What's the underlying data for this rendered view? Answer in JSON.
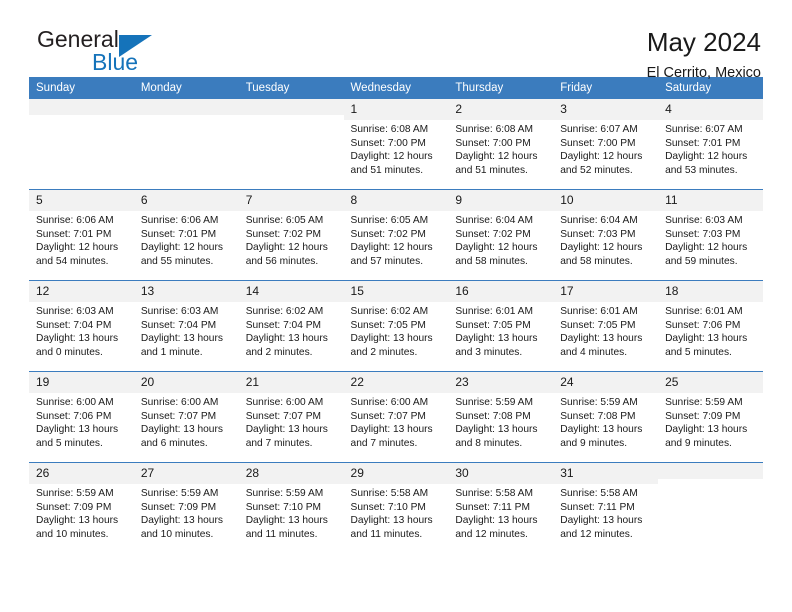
{
  "brand": {
    "name_top": "General",
    "name_bottom": "Blue",
    "triangle_color": "#1573ba",
    "text_color": "#231f20"
  },
  "header": {
    "title": "May 2024",
    "subtitle": "El Cerrito, Mexico",
    "header_bg": "#3b7cbe",
    "header_text": "#ffffff"
  },
  "weekday_headers": [
    "Sunday",
    "Monday",
    "Tuesday",
    "Wednesday",
    "Thursday",
    "Friday",
    "Saturday"
  ],
  "labels": {
    "sunrise": "Sunrise:",
    "sunset": "Sunset:",
    "daylight": "Daylight:"
  },
  "weeks": [
    [
      {
        "day": "",
        "empty": true
      },
      {
        "day": "",
        "empty": true
      },
      {
        "day": "",
        "empty": true
      },
      {
        "day": "1",
        "sunrise": "Sunrise: 6:08 AM",
        "sunset": "Sunset: 7:00 PM",
        "daylight_1": "Daylight: 12 hours",
        "daylight_2": "and 51 minutes."
      },
      {
        "day": "2",
        "sunrise": "Sunrise: 6:08 AM",
        "sunset": "Sunset: 7:00 PM",
        "daylight_1": "Daylight: 12 hours",
        "daylight_2": "and 51 minutes."
      },
      {
        "day": "3",
        "sunrise": "Sunrise: 6:07 AM",
        "sunset": "Sunset: 7:00 PM",
        "daylight_1": "Daylight: 12 hours",
        "daylight_2": "and 52 minutes."
      },
      {
        "day": "4",
        "sunrise": "Sunrise: 6:07 AM",
        "sunset": "Sunset: 7:01 PM",
        "daylight_1": "Daylight: 12 hours",
        "daylight_2": "and 53 minutes."
      }
    ],
    [
      {
        "day": "5",
        "sunrise": "Sunrise: 6:06 AM",
        "sunset": "Sunset: 7:01 PM",
        "daylight_1": "Daylight: 12 hours",
        "daylight_2": "and 54 minutes."
      },
      {
        "day": "6",
        "sunrise": "Sunrise: 6:06 AM",
        "sunset": "Sunset: 7:01 PM",
        "daylight_1": "Daylight: 12 hours",
        "daylight_2": "and 55 minutes."
      },
      {
        "day": "7",
        "sunrise": "Sunrise: 6:05 AM",
        "sunset": "Sunset: 7:02 PM",
        "daylight_1": "Daylight: 12 hours",
        "daylight_2": "and 56 minutes."
      },
      {
        "day": "8",
        "sunrise": "Sunrise: 6:05 AM",
        "sunset": "Sunset: 7:02 PM",
        "daylight_1": "Daylight: 12 hours",
        "daylight_2": "and 57 minutes."
      },
      {
        "day": "9",
        "sunrise": "Sunrise: 6:04 AM",
        "sunset": "Sunset: 7:02 PM",
        "daylight_1": "Daylight: 12 hours",
        "daylight_2": "and 58 minutes."
      },
      {
        "day": "10",
        "sunrise": "Sunrise: 6:04 AM",
        "sunset": "Sunset: 7:03 PM",
        "daylight_1": "Daylight: 12 hours",
        "daylight_2": "and 58 minutes."
      },
      {
        "day": "11",
        "sunrise": "Sunrise: 6:03 AM",
        "sunset": "Sunset: 7:03 PM",
        "daylight_1": "Daylight: 12 hours",
        "daylight_2": "and 59 minutes."
      }
    ],
    [
      {
        "day": "12",
        "sunrise": "Sunrise: 6:03 AM",
        "sunset": "Sunset: 7:04 PM",
        "daylight_1": "Daylight: 13 hours",
        "daylight_2": "and 0 minutes."
      },
      {
        "day": "13",
        "sunrise": "Sunrise: 6:03 AM",
        "sunset": "Sunset: 7:04 PM",
        "daylight_1": "Daylight: 13 hours",
        "daylight_2": "and 1 minute."
      },
      {
        "day": "14",
        "sunrise": "Sunrise: 6:02 AM",
        "sunset": "Sunset: 7:04 PM",
        "daylight_1": "Daylight: 13 hours",
        "daylight_2": "and 2 minutes."
      },
      {
        "day": "15",
        "sunrise": "Sunrise: 6:02 AM",
        "sunset": "Sunset: 7:05 PM",
        "daylight_1": "Daylight: 13 hours",
        "daylight_2": "and 2 minutes."
      },
      {
        "day": "16",
        "sunrise": "Sunrise: 6:01 AM",
        "sunset": "Sunset: 7:05 PM",
        "daylight_1": "Daylight: 13 hours",
        "daylight_2": "and 3 minutes."
      },
      {
        "day": "17",
        "sunrise": "Sunrise: 6:01 AM",
        "sunset": "Sunset: 7:05 PM",
        "daylight_1": "Daylight: 13 hours",
        "daylight_2": "and 4 minutes."
      },
      {
        "day": "18",
        "sunrise": "Sunrise: 6:01 AM",
        "sunset": "Sunset: 7:06 PM",
        "daylight_1": "Daylight: 13 hours",
        "daylight_2": "and 5 minutes."
      }
    ],
    [
      {
        "day": "19",
        "sunrise": "Sunrise: 6:00 AM",
        "sunset": "Sunset: 7:06 PM",
        "daylight_1": "Daylight: 13 hours",
        "daylight_2": "and 5 minutes."
      },
      {
        "day": "20",
        "sunrise": "Sunrise: 6:00 AM",
        "sunset": "Sunset: 7:07 PM",
        "daylight_1": "Daylight: 13 hours",
        "daylight_2": "and 6 minutes."
      },
      {
        "day": "21",
        "sunrise": "Sunrise: 6:00 AM",
        "sunset": "Sunset: 7:07 PM",
        "daylight_1": "Daylight: 13 hours",
        "daylight_2": "and 7 minutes."
      },
      {
        "day": "22",
        "sunrise": "Sunrise: 6:00 AM",
        "sunset": "Sunset: 7:07 PM",
        "daylight_1": "Daylight: 13 hours",
        "daylight_2": "and 7 minutes."
      },
      {
        "day": "23",
        "sunrise": "Sunrise: 5:59 AM",
        "sunset": "Sunset: 7:08 PM",
        "daylight_1": "Daylight: 13 hours",
        "daylight_2": "and 8 minutes."
      },
      {
        "day": "24",
        "sunrise": "Sunrise: 5:59 AM",
        "sunset": "Sunset: 7:08 PM",
        "daylight_1": "Daylight: 13 hours",
        "daylight_2": "and 9 minutes."
      },
      {
        "day": "25",
        "sunrise": "Sunrise: 5:59 AM",
        "sunset": "Sunset: 7:09 PM",
        "daylight_1": "Daylight: 13 hours",
        "daylight_2": "and 9 minutes."
      }
    ],
    [
      {
        "day": "26",
        "sunrise": "Sunrise: 5:59 AM",
        "sunset": "Sunset: 7:09 PM",
        "daylight_1": "Daylight: 13 hours",
        "daylight_2": "and 10 minutes."
      },
      {
        "day": "27",
        "sunrise": "Sunrise: 5:59 AM",
        "sunset": "Sunset: 7:09 PM",
        "daylight_1": "Daylight: 13 hours",
        "daylight_2": "and 10 minutes."
      },
      {
        "day": "28",
        "sunrise": "Sunrise: 5:59 AM",
        "sunset": "Sunset: 7:10 PM",
        "daylight_1": "Daylight: 13 hours",
        "daylight_2": "and 11 minutes."
      },
      {
        "day": "29",
        "sunrise": "Sunrise: 5:58 AM",
        "sunset": "Sunset: 7:10 PM",
        "daylight_1": "Daylight: 13 hours",
        "daylight_2": "and 11 minutes."
      },
      {
        "day": "30",
        "sunrise": "Sunrise: 5:58 AM",
        "sunset": "Sunset: 7:11 PM",
        "daylight_1": "Daylight: 13 hours",
        "daylight_2": "and 12 minutes."
      },
      {
        "day": "31",
        "sunrise": "Sunrise: 5:58 AM",
        "sunset": "Sunset: 7:11 PM",
        "daylight_1": "Daylight: 13 hours",
        "daylight_2": "and 12 minutes."
      },
      {
        "day": "",
        "empty": true
      }
    ]
  ]
}
